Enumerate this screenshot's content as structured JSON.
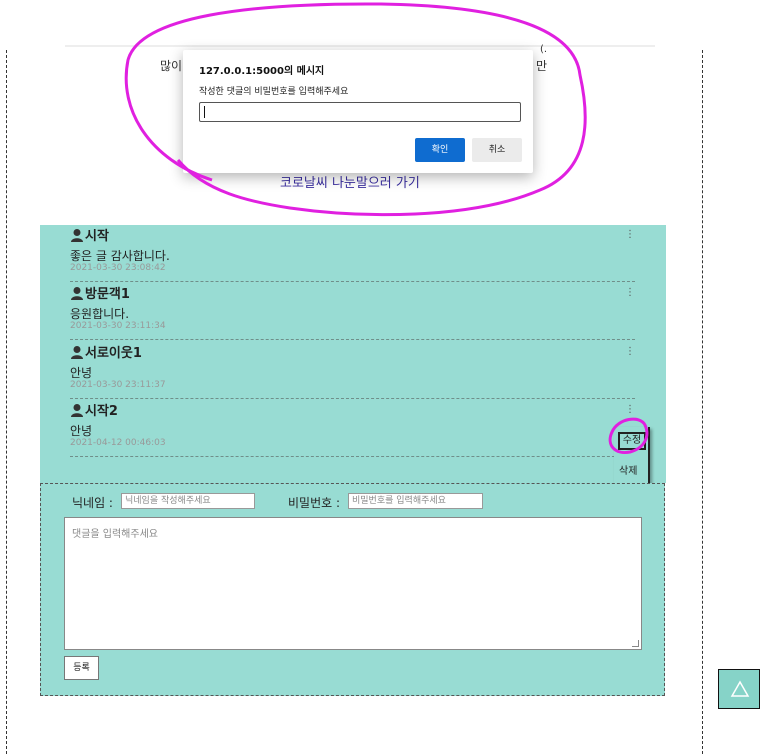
{
  "background": {
    "partial_line_left": "많이",
    "partial_line_right": "만",
    "corner_mark": "(.",
    "link_text": "코로날씨 나눈말으러 가기"
  },
  "comments": [
    {
      "author": "시작",
      "text": "좋은 글 감사합니다.",
      "date": "2021-03-30 23:08:42",
      "menu": "⋮"
    },
    {
      "author": "방문객1",
      "text": "응원합니다.",
      "date": "2021-03-30 23:11:34",
      "menu": "⋮"
    },
    {
      "author": "서로이웃1",
      "text": "안녕",
      "date": "2021-03-30 23:11:37",
      "menu": "⋮"
    },
    {
      "author": "시작2",
      "text": "안녕",
      "date": "2021-04-12 00:46:03",
      "menu": "⋮"
    }
  ],
  "comment_menu": {
    "edit": "수정",
    "delete": "삭제"
  },
  "form": {
    "nickname_label": "닉네임 :",
    "nickname_placeholder": "닉네임을 작성해주세요",
    "password_label": "비밀번호 :",
    "password_placeholder": "비밀번호를 입력해주세요",
    "comment_placeholder": "댓글을 입력해주세요",
    "submit": "등록"
  },
  "scroll_top_icon": "triangle-up-icon",
  "dialog": {
    "title": "127.0.0.1:5000의 메시지",
    "message": "작성한 댓글의 비밀번호를 입력해주세요",
    "input_value": "",
    "ok": "확인",
    "cancel": "취소"
  },
  "colors": {
    "comment_bg": "#98dcd3",
    "primary_button": "#0f6cd0",
    "annotation": "#e020e0"
  }
}
